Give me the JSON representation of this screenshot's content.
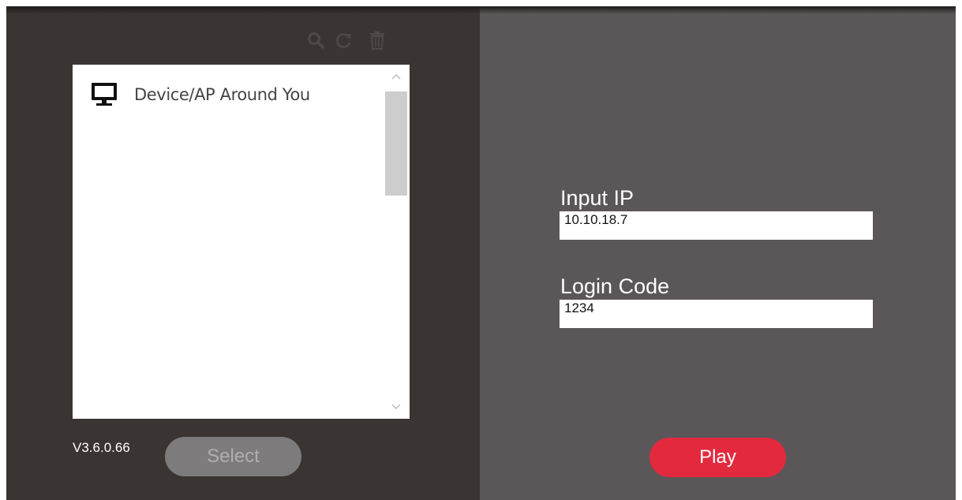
{
  "toolbar": {
    "icons": [
      "search-icon",
      "refresh-icon",
      "trash-icon"
    ]
  },
  "device_list": {
    "items": [
      {
        "icon": "monitor-icon",
        "label": "Device/AP Around You"
      }
    ]
  },
  "footer_left": {
    "version": "V3.6.0.66",
    "select_label": "Select"
  },
  "form": {
    "ip_label": "Input IP",
    "ip_value": "10.10.18.7",
    "login_label": "Login Code",
    "login_value": "1234",
    "play_label": "Play"
  },
  "colors": {
    "left_panel": "#3a3533",
    "right_panel": "#5b5758",
    "play_button": "#e3293e",
    "select_button_disabled": "#7d7b7b"
  }
}
